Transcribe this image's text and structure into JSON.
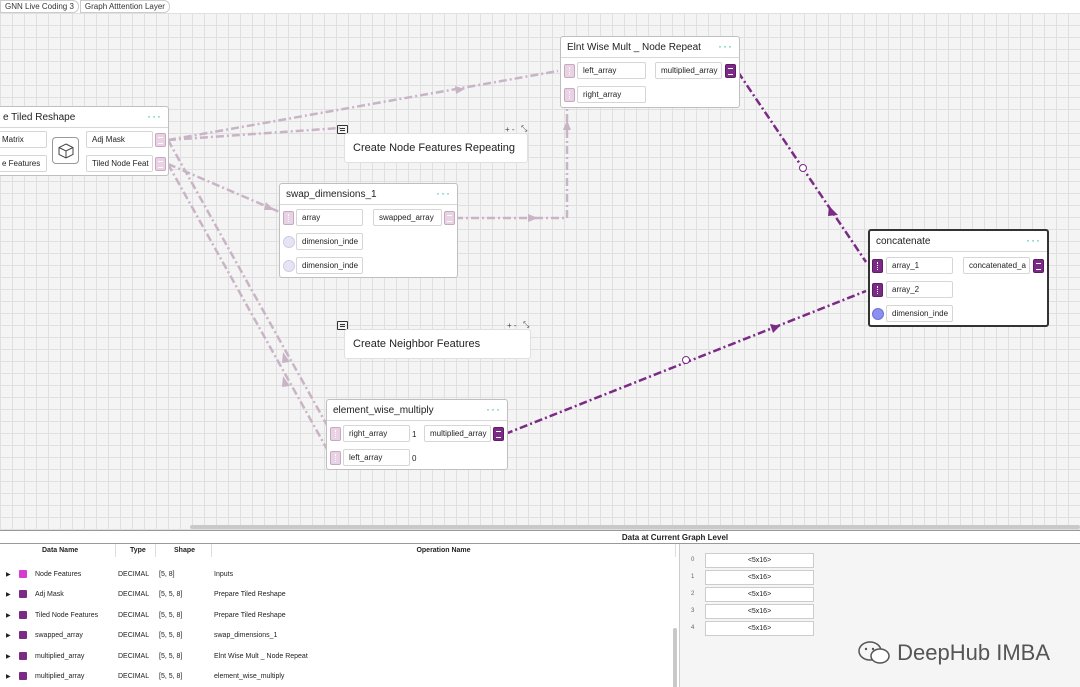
{
  "breadcrumbs": [
    "GNN Live Coding 3",
    "Graph Atttention Layer"
  ],
  "nodes": {
    "prepare": {
      "title": "e Tiled Reshape",
      "menu": "···",
      "inputs": [
        "Matrix",
        "e Features"
      ],
      "outputs": [
        "Adj Mask",
        "Tiled Node Feat"
      ]
    },
    "node_repeat": {
      "title": "Elnt Wise Mult _ Node Repeat",
      "menu": "···",
      "inputs": [
        "left_array",
        "right_array"
      ],
      "output": "multiplied_array"
    },
    "swap": {
      "title": "swap_dimensions_1",
      "menu": "···",
      "inputs": [
        "array",
        "dimension_inde",
        "dimension_inde"
      ],
      "output": "swapped_array"
    },
    "concat": {
      "title": "concatenate",
      "menu": "···",
      "inputs": [
        "array_1",
        "array_2",
        "dimension_inde"
      ],
      "output": "concatenated_a"
    },
    "ewm": {
      "title": "element_wise_multiply",
      "menu": "···",
      "inputs": [
        "right_array",
        "left_array"
      ],
      "input_values": [
        "1",
        "0"
      ],
      "output": "multiplied_array"
    }
  },
  "comments": {
    "repeating": "Create Node Features Repeating",
    "neighbor": "Create Neighbor Features",
    "controls": "+ -"
  },
  "panel": {
    "title": "Data at Current Graph Level",
    "headers": [
      "Data Name",
      "Type",
      "Shape",
      "Operation Name"
    ],
    "rows": [
      {
        "name": "Node Features",
        "type": "DECIMAL",
        "shape": "[5, 8]",
        "op": "Inputs"
      },
      {
        "name": "Adj Mask",
        "type": "DECIMAL",
        "shape": "[5, 5, 8]",
        "op": "Prepare Tiled Reshape"
      },
      {
        "name": "Tiled Node Features",
        "type": "DECIMAL",
        "shape": "[5, 5, 8]",
        "op": "Prepare Tiled Reshape"
      },
      {
        "name": "swapped_array",
        "type": "DECIMAL",
        "shape": "[5, 5, 8]",
        "op": "swap_dimensions_1"
      },
      {
        "name": "multiplied_array",
        "type": "DECIMAL",
        "shape": "[5, 5, 8]",
        "op": "Elnt Wise Mult _ Node Repeat"
      },
      {
        "name": "multiplied_array",
        "type": "DECIMAL",
        "shape": "[5, 5, 8]",
        "op": "element_wise_multiply"
      }
    ],
    "right_indices": [
      "0",
      "1",
      "2",
      "3",
      "4"
    ],
    "right_values": [
      "<5x16>",
      "<5x16>",
      "<5x16>",
      "<5x16>",
      "<5x16>"
    ]
  },
  "watermark": "DeepHub IMBA",
  "colors": {
    "accent": "#7b2a85",
    "menu_dots": "#2bb5a3",
    "edge_light": "#c9b4c6"
  }
}
